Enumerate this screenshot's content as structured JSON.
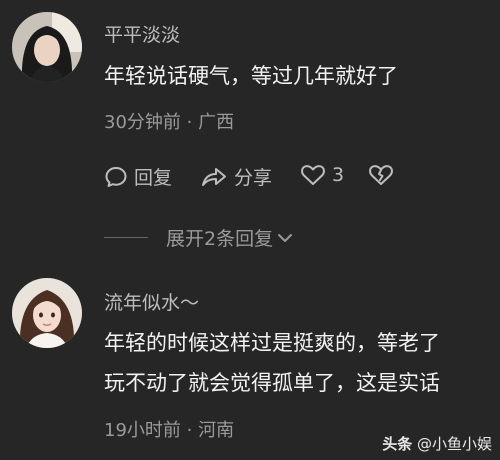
{
  "comments": [
    {
      "username": "平平淡淡",
      "lines": [
        "年轻说话硬气，等过几年就好了"
      ],
      "time_location": "30分钟前 · 广西",
      "actions": {
        "reply": "回复",
        "share": "分享",
        "like_count": "3"
      },
      "expand": "展开2条回复"
    },
    {
      "username": "流年似水～",
      "lines": [
        "年轻的时候这样过是挺爽的，等老了",
        "玩不动了就会觉得孤单了，这是实话"
      ],
      "time_location": "19小时前 · 河南"
    }
  ],
  "watermark": {
    "logo": "头条",
    "account": "@小鱼小娱"
  },
  "icons": {
    "reply": "comment-bubble-icon",
    "share": "share-arrow-icon",
    "like": "heart-icon",
    "dislike": "broken-heart-icon",
    "expand": "chevron-down-icon"
  }
}
